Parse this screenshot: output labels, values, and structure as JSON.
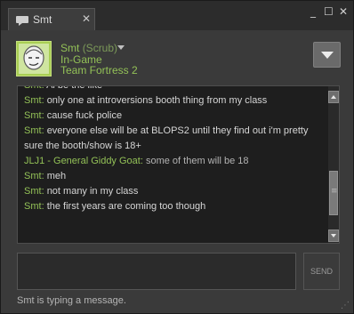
{
  "window": {
    "tab_title": "Smt",
    "tab_close": "✕",
    "controls": {
      "minimize": "_",
      "maximize": "☐",
      "close": "✕"
    }
  },
  "friend": {
    "name": "Smt",
    "nickname": "(Scrub)",
    "status": "In-Game",
    "game": "Team Fortress 2",
    "avatar_color": "#a9cf54"
  },
  "chat": {
    "messages": [
      {
        "sender": "Smt",
        "text": "Ai be the like"
      },
      {
        "sender": "Smt",
        "text": "only one at introversions booth thing from my class"
      },
      {
        "sender": "Smt",
        "text": "cause fuck police"
      },
      {
        "sender": "Smt",
        "text": "everyone else will be at BLOPS2 until they find out i'm pretty sure the booth/show is 18+"
      },
      {
        "sender": "JLJ1 - General Giddy Goat",
        "text": "some of them will be 18"
      },
      {
        "sender": "Smt",
        "text": "meh"
      },
      {
        "sender": "Smt",
        "text": "not many in my class"
      },
      {
        "sender": "Smt",
        "text": "the first years are coming too though"
      }
    ]
  },
  "input": {
    "value": "",
    "send_label": "SEND"
  },
  "status_line": "Smt is typing a message.",
  "colors": {
    "accent": "#93c157",
    "background": "#3a3a3a",
    "log_background": "#1e1e1e"
  }
}
